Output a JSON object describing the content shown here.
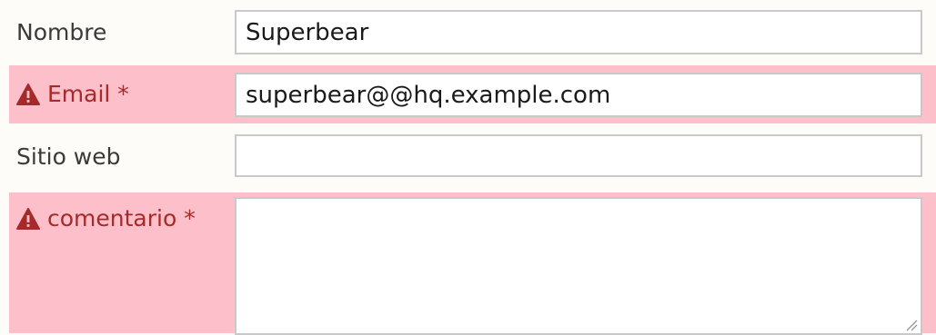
{
  "form": {
    "nombre": {
      "label": "Nombre",
      "value": "Superbear",
      "error": false
    },
    "email": {
      "label": "Email *",
      "value": "superbear@@hq.example.com",
      "error": true,
      "error_icon": "warning-triangle-icon"
    },
    "sitio_web": {
      "label": "Sitio web",
      "value": "",
      "error": false
    },
    "comentario": {
      "label": "comentario *",
      "value": "",
      "error": true,
      "error_icon": "warning-triangle-icon"
    }
  },
  "colors": {
    "error_background": "#fdc0cb",
    "error_text": "#a52a2a",
    "page_background": "#fdfcf8",
    "input_border": "#c9c9c9"
  }
}
